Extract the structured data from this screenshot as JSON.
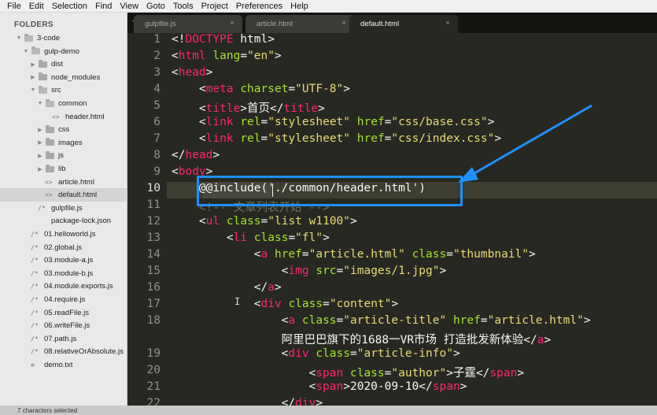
{
  "menu": [
    "File",
    "Edit",
    "Selection",
    "Find",
    "View",
    "Goto",
    "Tools",
    "Project",
    "Preferences",
    "Help"
  ],
  "sidebar": {
    "title": "FOLDERS",
    "items": [
      {
        "label": "3-code",
        "type": "folder",
        "open": true,
        "depth": 0
      },
      {
        "label": "gulp-demo",
        "type": "folder",
        "open": true,
        "depth": 1
      },
      {
        "label": "dist",
        "type": "folder",
        "open": false,
        "depth": 2
      },
      {
        "label": "node_modules",
        "type": "folder",
        "open": false,
        "depth": 2
      },
      {
        "label": "src",
        "type": "folder",
        "open": true,
        "depth": 2
      },
      {
        "label": "common",
        "type": "folder",
        "open": true,
        "depth": 3
      },
      {
        "label": "header.html",
        "type": "file",
        "icon": "<>",
        "depth": 4
      },
      {
        "label": "css",
        "type": "folder",
        "open": false,
        "depth": 3
      },
      {
        "label": "images",
        "type": "folder",
        "open": false,
        "depth": 3
      },
      {
        "label": "js",
        "type": "folder",
        "open": false,
        "depth": 3
      },
      {
        "label": "lib",
        "type": "folder",
        "open": false,
        "depth": 3
      },
      {
        "label": "article.html",
        "type": "file",
        "icon": "<>",
        "depth": 3
      },
      {
        "label": "default.html",
        "type": "file",
        "icon": "<>",
        "depth": 3,
        "selected": true
      },
      {
        "label": "gulpfile.js",
        "type": "file",
        "icon": "/*",
        "depth": 2
      },
      {
        "label": "package-lock.json",
        "type": "file",
        "icon": "",
        "depth": 2
      },
      {
        "label": "01.helloworld.js",
        "type": "file",
        "icon": "/*",
        "depth": 1
      },
      {
        "label": "02.global.js",
        "type": "file",
        "icon": "/*",
        "depth": 1
      },
      {
        "label": "03.module-a.js",
        "type": "file",
        "icon": "/*",
        "depth": 1
      },
      {
        "label": "03.module-b.js",
        "type": "file",
        "icon": "/*",
        "depth": 1
      },
      {
        "label": "04.module.exports.js",
        "type": "file",
        "icon": "/*",
        "depth": 1
      },
      {
        "label": "04.require.js",
        "type": "file",
        "icon": "/*",
        "depth": 1
      },
      {
        "label": "05.readFile.js",
        "type": "file",
        "icon": "/*",
        "depth": 1
      },
      {
        "label": "06.writeFile.js",
        "type": "file",
        "icon": "/*",
        "depth": 1
      },
      {
        "label": "07.path.js",
        "type": "file",
        "icon": "/*",
        "depth": 1
      },
      {
        "label": "08.relativeOrAbsolute.js",
        "type": "file",
        "icon": "/*",
        "depth": 1
      },
      {
        "label": "demo.txt",
        "type": "file",
        "icon": "≡",
        "depth": 1
      }
    ]
  },
  "tabs": [
    {
      "label": "gulpfile.js",
      "active": false
    },
    {
      "label": "article.html",
      "active": false
    },
    {
      "label": "default.html",
      "active": true
    }
  ],
  "editor": {
    "current_line": 10,
    "lines": [
      {
        "n": "1",
        "tokens": [
          [
            "plain",
            "<!"
          ],
          [
            "doct",
            "DOCTYPE"
          ],
          [
            "plain",
            " html>"
          ]
        ]
      },
      {
        "n": "2",
        "tokens": [
          [
            "plain",
            "<"
          ],
          [
            "tag",
            "html"
          ],
          [
            "plain",
            " "
          ],
          [
            "attr",
            "lang"
          ],
          [
            "plain",
            "="
          ],
          [
            "str",
            "\"en\""
          ],
          [
            "plain",
            ">"
          ]
        ]
      },
      {
        "n": "3",
        "tokens": [
          [
            "plain",
            "<"
          ],
          [
            "tag",
            "head"
          ],
          [
            "plain",
            ">"
          ]
        ]
      },
      {
        "n": "4",
        "tokens": [
          [
            "plain",
            "    <"
          ],
          [
            "tag",
            "meta"
          ],
          [
            "plain",
            " "
          ],
          [
            "attr",
            "charset"
          ],
          [
            "plain",
            "="
          ],
          [
            "str",
            "\"UTF-8\""
          ],
          [
            "plain",
            ">"
          ]
        ]
      },
      {
        "n": "5",
        "tokens": [
          [
            "plain",
            "    <"
          ],
          [
            "tag",
            "title"
          ],
          [
            "plain",
            ">首页</"
          ],
          [
            "tag",
            "title"
          ],
          [
            "plain",
            ">"
          ]
        ]
      },
      {
        "n": "6",
        "tokens": [
          [
            "plain",
            "    <"
          ],
          [
            "tag",
            "link"
          ],
          [
            "plain",
            " "
          ],
          [
            "attr",
            "rel"
          ],
          [
            "plain",
            "="
          ],
          [
            "str",
            "\"stylesheet\""
          ],
          [
            "plain",
            " "
          ],
          [
            "attr",
            "href"
          ],
          [
            "plain",
            "="
          ],
          [
            "str",
            "\"css/base.css\""
          ],
          [
            "plain",
            ">"
          ]
        ]
      },
      {
        "n": "7",
        "tokens": [
          [
            "plain",
            "    <"
          ],
          [
            "tag",
            "link"
          ],
          [
            "plain",
            " "
          ],
          [
            "attr",
            "rel"
          ],
          [
            "plain",
            "="
          ],
          [
            "str",
            "\"stylesheet\""
          ],
          [
            "plain",
            " "
          ],
          [
            "attr",
            "href"
          ],
          [
            "plain",
            "="
          ],
          [
            "str",
            "\"css/index.css\""
          ],
          [
            "plain",
            ">"
          ]
        ]
      },
      {
        "n": "8",
        "tokens": [
          [
            "plain",
            "</"
          ],
          [
            "tag",
            "head"
          ],
          [
            "plain",
            ">"
          ]
        ]
      },
      {
        "n": "9",
        "tokens": [
          [
            "plain",
            "<"
          ],
          [
            "tag",
            "body"
          ],
          [
            "plain",
            ">"
          ]
        ]
      },
      {
        "n": "10",
        "tokens": [
          [
            "plain",
            "    @@include('./common/header.html')"
          ]
        ]
      },
      {
        "n": "11",
        "tokens": [
          [
            "comment",
            "    <!-- 文章列表开始 -->"
          ]
        ]
      },
      {
        "n": "12",
        "tokens": [
          [
            "plain",
            "    <"
          ],
          [
            "tag",
            "ul"
          ],
          [
            "plain",
            " "
          ],
          [
            "attr",
            "class"
          ],
          [
            "plain",
            "="
          ],
          [
            "str",
            "\"list w1100\""
          ],
          [
            "plain",
            ">"
          ]
        ]
      },
      {
        "n": "13",
        "tokens": [
          [
            "plain",
            "        <"
          ],
          [
            "tag",
            "li"
          ],
          [
            "plain",
            " "
          ],
          [
            "attr",
            "class"
          ],
          [
            "plain",
            "="
          ],
          [
            "str",
            "\"fl\""
          ],
          [
            "plain",
            ">"
          ]
        ]
      },
      {
        "n": "14",
        "tokens": [
          [
            "plain",
            "            <"
          ],
          [
            "tag",
            "a"
          ],
          [
            "plain",
            " "
          ],
          [
            "attr",
            "href"
          ],
          [
            "plain",
            "="
          ],
          [
            "str",
            "\"article.html\""
          ],
          [
            "plain",
            " "
          ],
          [
            "attr",
            "class"
          ],
          [
            "plain",
            "="
          ],
          [
            "str",
            "\"thumbnail\""
          ],
          [
            "plain",
            ">"
          ]
        ]
      },
      {
        "n": "15",
        "tokens": [
          [
            "plain",
            "                <"
          ],
          [
            "tag",
            "img"
          ],
          [
            "plain",
            " "
          ],
          [
            "attr",
            "src"
          ],
          [
            "plain",
            "="
          ],
          [
            "str",
            "\"images/1.jpg\""
          ],
          [
            "plain",
            ">"
          ]
        ]
      },
      {
        "n": "16",
        "tokens": [
          [
            "plain",
            "            </"
          ],
          [
            "tag",
            "a"
          ],
          [
            "plain",
            ">"
          ]
        ]
      },
      {
        "n": "17",
        "tokens": [
          [
            "plain",
            "            <"
          ],
          [
            "tag",
            "div"
          ],
          [
            "plain",
            " "
          ],
          [
            "attr",
            "class"
          ],
          [
            "plain",
            "="
          ],
          [
            "str",
            "\"content\""
          ],
          [
            "plain",
            ">"
          ]
        ]
      },
      {
        "n": "18",
        "tokens": [
          [
            "plain",
            "                <"
          ],
          [
            "tag",
            "a"
          ],
          [
            "plain",
            " "
          ],
          [
            "attr",
            "class"
          ],
          [
            "plain",
            "="
          ],
          [
            "str",
            "\"article-title\""
          ],
          [
            "plain",
            " "
          ],
          [
            "attr",
            "href"
          ],
          [
            "plain",
            "="
          ],
          [
            "str",
            "\"article.html\""
          ],
          [
            "plain",
            ">"
          ]
        ]
      },
      {
        "n": "",
        "tokens": [
          [
            "plain",
            "                阿里巴巴旗下的1688一VR市场 打造批发新体验</"
          ],
          [
            "tag",
            "a"
          ],
          [
            "plain",
            ">"
          ]
        ]
      },
      {
        "n": "19",
        "tokens": [
          [
            "plain",
            "                <"
          ],
          [
            "tag",
            "div"
          ],
          [
            "plain",
            " "
          ],
          [
            "attr",
            "class"
          ],
          [
            "plain",
            "="
          ],
          [
            "str",
            "\"article-info\""
          ],
          [
            "plain",
            ">"
          ]
        ]
      },
      {
        "n": "20",
        "tokens": [
          [
            "plain",
            "                    <"
          ],
          [
            "tag",
            "span"
          ],
          [
            "plain",
            " "
          ],
          [
            "attr",
            "class"
          ],
          [
            "plain",
            "="
          ],
          [
            "str",
            "\"author\""
          ],
          [
            "plain",
            ">子霆</"
          ],
          [
            "tag",
            "span"
          ],
          [
            "plain",
            ">"
          ]
        ]
      },
      {
        "n": "21",
        "tokens": [
          [
            "plain",
            "                    <"
          ],
          [
            "tag",
            "span"
          ],
          [
            "plain",
            ">2020-09-10</"
          ],
          [
            "tag",
            "span"
          ],
          [
            "plain",
            ">"
          ]
        ]
      },
      {
        "n": "22",
        "tokens": [
          [
            "plain",
            "                </"
          ],
          [
            "tag",
            "div"
          ],
          [
            "plain",
            ">"
          ]
        ]
      }
    ]
  },
  "status": "7 characters selected",
  "colors": {
    "highlight": "#1e90ff",
    "tag": "#f92672",
    "attr": "#a6e22e",
    "string": "#e6db74"
  }
}
